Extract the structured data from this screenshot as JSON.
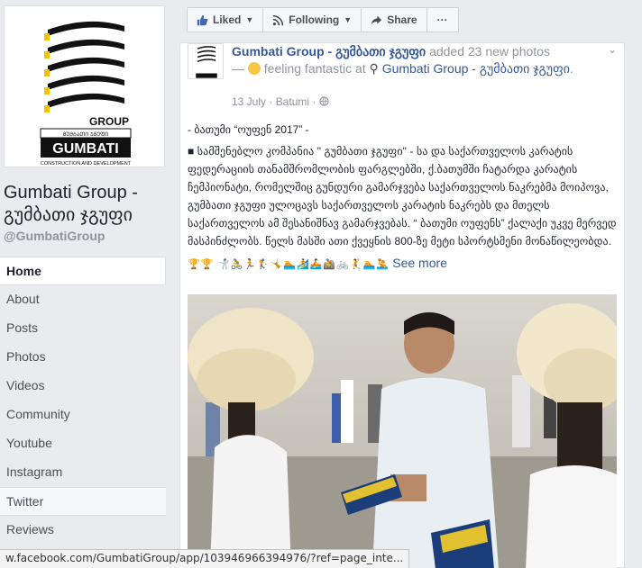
{
  "page": {
    "name": "Gumbati Group - გუმბათი ჯგუფი",
    "handle": "@GumbatiGroup",
    "logo": {
      "word1": "GROUP",
      "word2": "GUMBATI",
      "tagline": "CONSTRUCTION AND DEVELOPMENT",
      "small": "ᲒᲣᲛᲑᲐᲗᲘ ᲯᲒᲣᲤᲘ"
    }
  },
  "nav": [
    {
      "label": "Home",
      "active": true
    },
    {
      "label": "About"
    },
    {
      "label": "Posts"
    },
    {
      "label": "Photos"
    },
    {
      "label": "Videos"
    },
    {
      "label": "Community"
    },
    {
      "label": "Youtube"
    },
    {
      "label": "Instagram"
    },
    {
      "label": "Twitter",
      "hover": true
    },
    {
      "label": "Reviews"
    }
  ],
  "actions": {
    "liked": "Liked",
    "following": "Following",
    "share": "Share",
    "more": "···"
  },
  "post": {
    "author": "Gumbati Group - გუმბათი ჯგუფი",
    "action": " added 23 new photos",
    "feeling_prefix": " — ",
    "feeling": " feeling fantastic at ",
    "place": "Gumbati Group - გუმბათი ჯგუფი",
    "place_end": ".",
    "date": "13 July",
    "location": "Batumi",
    "heading": "- ბათუმი “ოუფენ 2017” -",
    "text": "■ სამშენებლო კომპანია \" გუმბათი ჯგუფი\" - სა და საქართველოს კარატის ფედერაციის თანამშრომლობის ფარგლებში, ქ.ბათუმში ჩატარდა კარატის ჩემპიონატი, რომელშიც გუნდური გამარჯვება საქართველოს ნაკრებმა მოიპოვა, გუმბათი ჯგუფი ულოცავს საქართველოს კარატის ნაკრებს და მთელს საქართველოს ამ შესანიშნავ გამარჯვებას. “ ბათუმი ოუფენს” ქალაქი უკვე მერვედ მასპინძლობს. წელს მასში ათი ქვეყნის 800-ზე მეტი სპორტსმენი მონაწილეობდა.",
    "emoji": [
      "🏆",
      "🏆",
      "🤺",
      "🚴",
      "🏃",
      "🏌",
      "🤸",
      "🏊",
      "🏄",
      "🚣",
      "🚵",
      "🚲",
      "🤾",
      "🏊",
      "🤽"
    ],
    "see_more": "See more"
  },
  "status_url": "w.facebook.com/GumbatiGroup/app/103946966394976/?ref=page_inte..."
}
